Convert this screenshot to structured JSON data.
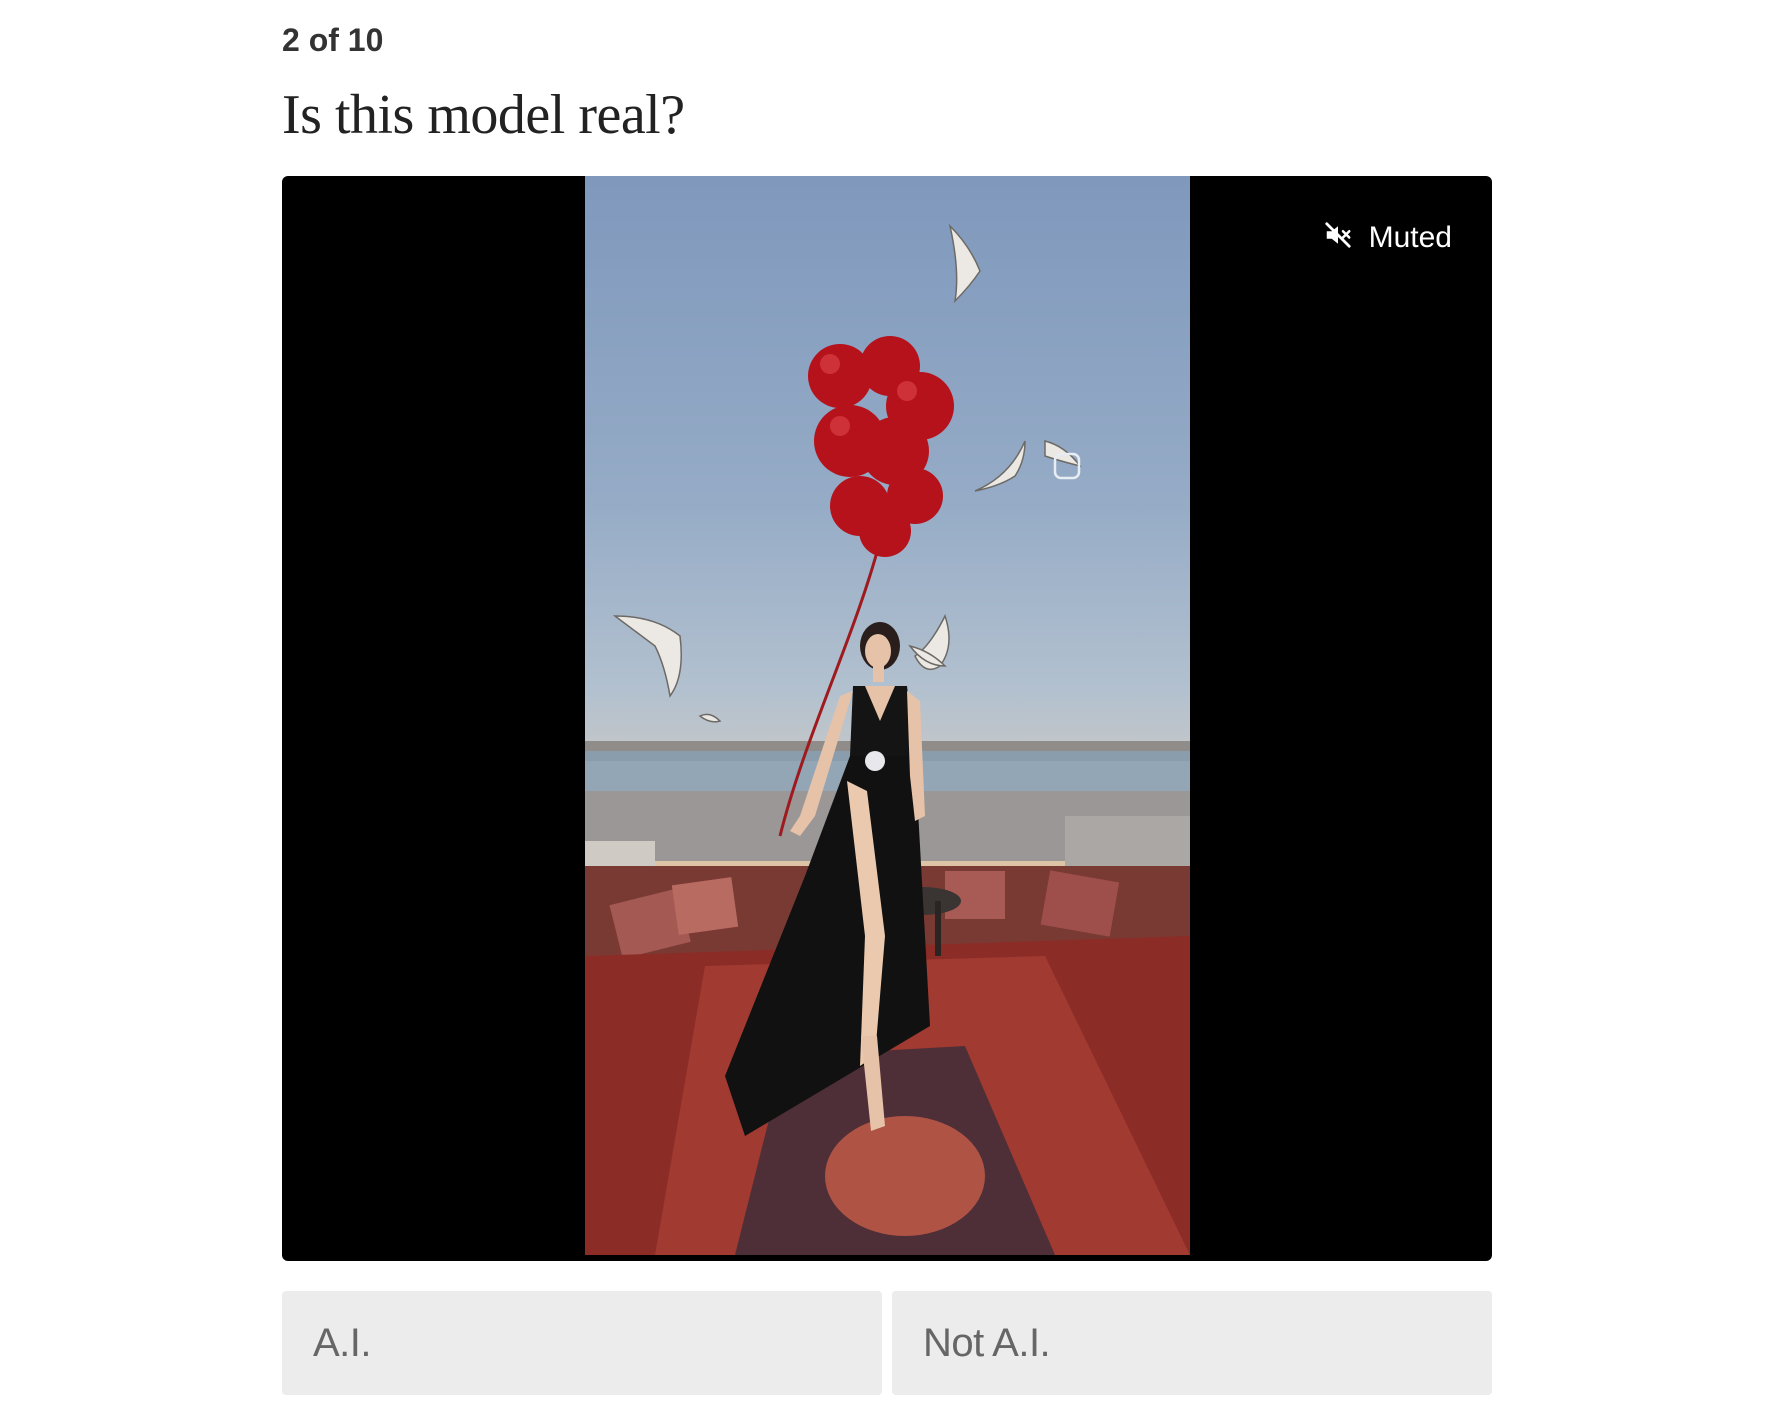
{
  "quiz": {
    "progress": "2 of 10",
    "question": "Is this model real?"
  },
  "video": {
    "mute_label": "Muted",
    "mute_icon": "speaker-muted-icon",
    "colors": {
      "player_background": "#000000",
      "balloon": "#b5121b",
      "dress": "#111111",
      "rug": "#8c2c27"
    }
  },
  "answers": {
    "option_a": "A.I.",
    "option_b": "Not A.I."
  }
}
